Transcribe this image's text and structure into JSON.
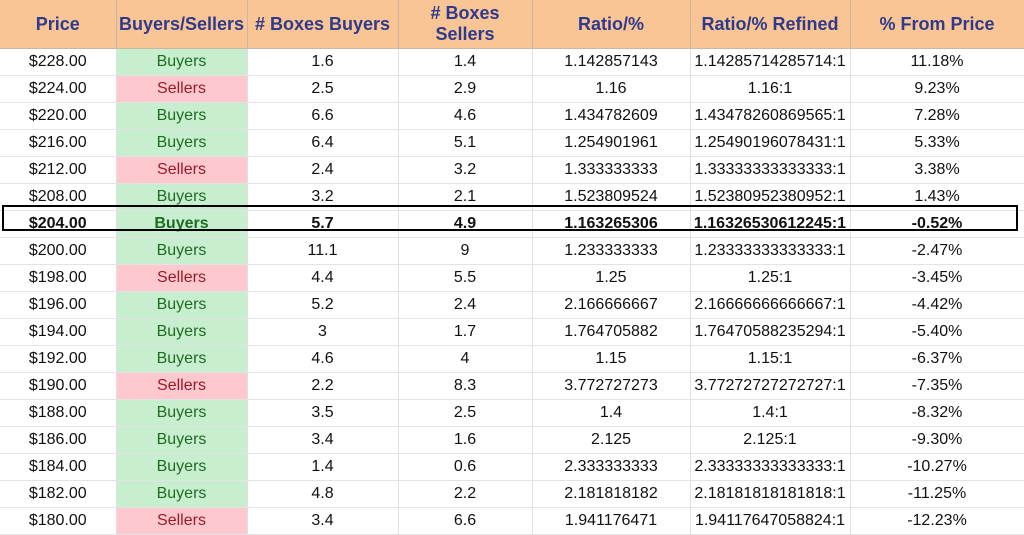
{
  "headers": [
    "Price",
    "Buyers/Sellers",
    "# Boxes Buyers",
    "# Boxes Sellers",
    "Ratio/%",
    "Ratio/% Refined",
    "% From Price"
  ],
  "rows": [
    {
      "price": "$228.00",
      "side": "Buyers",
      "buyers": "1.6",
      "sellers": "1.4",
      "ratio": "1.142857143",
      "refined": "1.14285714285714:1",
      "pct": "11.18%",
      "bold": false
    },
    {
      "price": "$224.00",
      "side": "Sellers",
      "buyers": "2.5",
      "sellers": "2.9",
      "ratio": "1.16",
      "refined": "1.16:1",
      "pct": "9.23%",
      "bold": false
    },
    {
      "price": "$220.00",
      "side": "Buyers",
      "buyers": "6.6",
      "sellers": "4.6",
      "ratio": "1.434782609",
      "refined": "1.43478260869565:1",
      "pct": "7.28%",
      "bold": false
    },
    {
      "price": "$216.00",
      "side": "Buyers",
      "buyers": "6.4",
      "sellers": "5.1",
      "ratio": "1.254901961",
      "refined": "1.25490196078431:1",
      "pct": "5.33%",
      "bold": false
    },
    {
      "price": "$212.00",
      "side": "Sellers",
      "buyers": "2.4",
      "sellers": "3.2",
      "ratio": "1.333333333",
      "refined": "1.33333333333333:1",
      "pct": "3.38%",
      "bold": false
    },
    {
      "price": "$208.00",
      "side": "Buyers",
      "buyers": "3.2",
      "sellers": "2.1",
      "ratio": "1.523809524",
      "refined": "1.52380952380952:1",
      "pct": "1.43%",
      "bold": false
    },
    {
      "price": "$204.00",
      "side": "Buyers",
      "buyers": "5.7",
      "sellers": "4.9",
      "ratio": "1.163265306",
      "refined": "1.16326530612245:1",
      "pct": "-0.52%",
      "bold": true
    },
    {
      "price": "$200.00",
      "side": "Buyers",
      "buyers": "11.1",
      "sellers": "9",
      "ratio": "1.233333333",
      "refined": "1.23333333333333:1",
      "pct": "-2.47%",
      "bold": false
    },
    {
      "price": "$198.00",
      "side": "Sellers",
      "buyers": "4.4",
      "sellers": "5.5",
      "ratio": "1.25",
      "refined": "1.25:1",
      "pct": "-3.45%",
      "bold": false
    },
    {
      "price": "$196.00",
      "side": "Buyers",
      "buyers": "5.2",
      "sellers": "2.4",
      "ratio": "2.166666667",
      "refined": "2.16666666666667:1",
      "pct": "-4.42%",
      "bold": false
    },
    {
      "price": "$194.00",
      "side": "Buyers",
      "buyers": "3",
      "sellers": "1.7",
      "ratio": "1.764705882",
      "refined": "1.76470588235294:1",
      "pct": "-5.40%",
      "bold": false
    },
    {
      "price": "$192.00",
      "side": "Buyers",
      "buyers": "4.6",
      "sellers": "4",
      "ratio": "1.15",
      "refined": "1.15:1",
      "pct": "-6.37%",
      "bold": false
    },
    {
      "price": "$190.00",
      "side": "Sellers",
      "buyers": "2.2",
      "sellers": "8.3",
      "ratio": "3.772727273",
      "refined": "3.77272727272727:1",
      "pct": "-7.35%",
      "bold": false
    },
    {
      "price": "$188.00",
      "side": "Buyers",
      "buyers": "3.5",
      "sellers": "2.5",
      "ratio": "1.4",
      "refined": "1.4:1",
      "pct": "-8.32%",
      "bold": false
    },
    {
      "price": "$186.00",
      "side": "Buyers",
      "buyers": "3.4",
      "sellers": "1.6",
      "ratio": "2.125",
      "refined": "2.125:1",
      "pct": "-9.30%",
      "bold": false
    },
    {
      "price": "$184.00",
      "side": "Buyers",
      "buyers": "1.4",
      "sellers": "0.6",
      "ratio": "2.333333333",
      "refined": "2.33333333333333:1",
      "pct": "-10.27%",
      "bold": false
    },
    {
      "price": "$182.00",
      "side": "Buyers",
      "buyers": "4.8",
      "sellers": "2.2",
      "ratio": "2.181818182",
      "refined": "2.18181818181818:1",
      "pct": "-11.25%",
      "bold": false
    },
    {
      "price": "$180.00",
      "side": "Sellers",
      "buyers": "3.4",
      "sellers": "6.6",
      "ratio": "1.941176471",
      "refined": "1.94117647058824:1",
      "pct": "-12.23%",
      "bold": false
    }
  ],
  "colors": {
    "header_bg": "#f9c595",
    "header_text": "#2e3a8c",
    "buyers_bg": "#c7efcf",
    "buyers_text": "#1f6b22",
    "sellers_bg": "#fdc8ce",
    "sellers_text": "#9c1a26"
  }
}
